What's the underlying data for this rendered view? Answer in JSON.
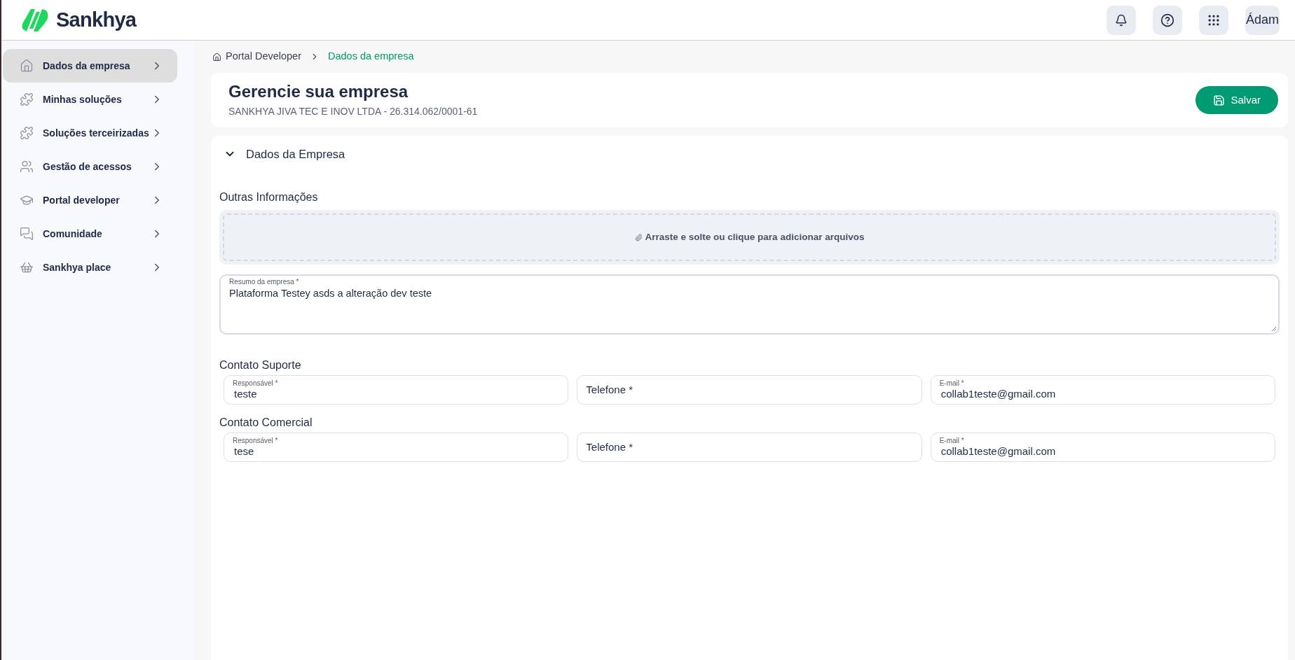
{
  "header": {
    "logo": "Sankhya",
    "avatar_alt": "Ádam"
  },
  "sidebar": {
    "items": [
      {
        "label": "Dados da empresa",
        "selected": true
      },
      {
        "label": "Minhas soluções",
        "selected": false
      },
      {
        "label": "Soluções terceirizadas",
        "selected": false
      },
      {
        "label": "Gestão de acessos",
        "selected": false
      },
      {
        "label": "Portal developer",
        "selected": false
      },
      {
        "label": "Comunidade",
        "selected": false
      },
      {
        "label": "Sankhya place",
        "selected": false
      }
    ]
  },
  "breadcrumb": [
    {
      "label": "Portal Developer",
      "selected": false
    },
    {
      "label": "Dados da empresa",
      "selected": true
    }
  ],
  "page": {
    "title": "Gerencie sua empresa",
    "subtitle": "SANKHYA JIVA TEC E INOV LTDA - 26.314.062/0001-61",
    "save_button": "Salvar"
  },
  "section": {
    "title": "Dados da Empresa",
    "expanded": true,
    "other_info_heading": "Outras Informações",
    "dropzone": "Arraste e solte ou clique para adicionar arquivos",
    "summary": {
      "label": "Resumo da empresa *",
      "value": "Plataforma Testey asds a alteração dev teste"
    },
    "contact_groups": [
      {
        "heading": "Contato Suporte",
        "fields": [
          {
            "label": "Responsável *",
            "value": "teste"
          },
          {
            "label": "Telefone *"
          },
          {
            "label": "E-mail *",
            "value": "collab1teste@gmail.com"
          }
        ]
      },
      {
        "heading": "Contato Comercial",
        "fields": [
          {
            "label": "Responsável *",
            "value": "tese"
          },
          {
            "label": "Telefone *"
          },
          {
            "label": "E-mail *",
            "value": "collab1teste@gmail.com"
          }
        ]
      }
    ]
  }
}
